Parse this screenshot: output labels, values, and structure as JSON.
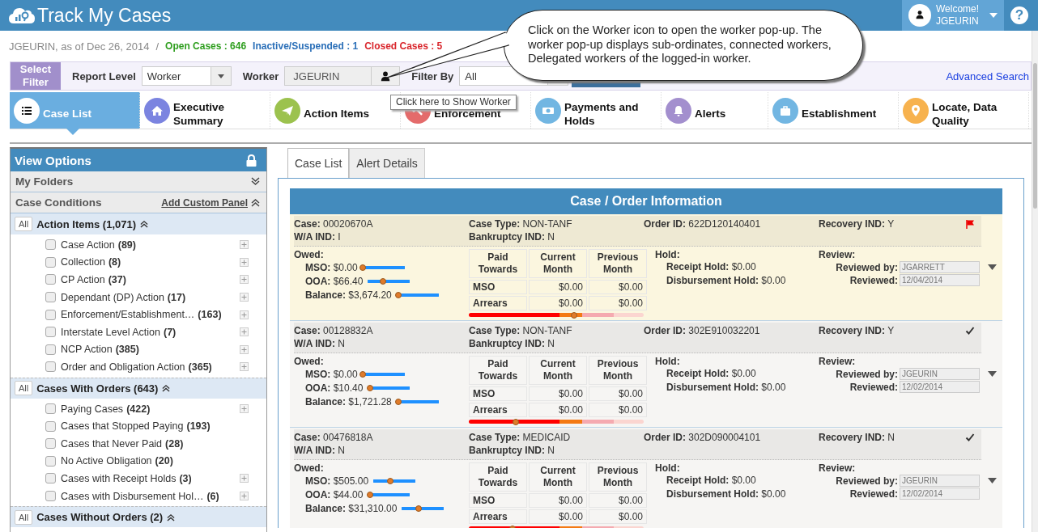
{
  "header": {
    "title": "Track My Cases",
    "welcome": "Welcome!",
    "user": "JGEURIN",
    "help": "?"
  },
  "summary": {
    "user_date": "JGEURIN, as of Dec 26, 2014",
    "separator": "/",
    "stats": [
      {
        "label": "Open Cases : 646",
        "color": "#2e9e1e"
      },
      {
        "label": "Inactive/Suspended : 1",
        "color": "#2a6fb8"
      },
      {
        "label": "Closed Cases : 5",
        "color": "#d9262c"
      }
    ]
  },
  "filter": {
    "select_filter": "Select Filter",
    "report_level_label": "Report Level",
    "report_level": "Worker",
    "worker_label": "Worker",
    "worker": "JGEURIN",
    "filter_by_label": "Filter By",
    "filter_by": "All",
    "advanced_search": "Advanced Search"
  },
  "tooltip": "Click here to Show Worker",
  "callout": "Click on the Worker icon to open the worker pop-up. The worker pop-up displays sub-ordinates, connected workers, Delegated workers of the logged-in worker.",
  "nav_tabs": [
    {
      "label": "Case List",
      "kind": "list",
      "color": "#ffffff",
      "selected": true
    },
    {
      "label": "Executive Summary",
      "kind": "home",
      "color": "#7b84e0",
      "selected": false
    },
    {
      "label": "Action Items",
      "kind": "plane",
      "color": "#9cc24e",
      "selected": false
    },
    {
      "label": "Enforcement",
      "kind": "hammer",
      "color": "#e46b6b",
      "selected": false
    },
    {
      "label": "Payments and Holds",
      "kind": "money",
      "color": "#72b6e2",
      "selected": false
    },
    {
      "label": "Alerts",
      "kind": "bell",
      "color": "#a38fce",
      "selected": false
    },
    {
      "label": "Establishment",
      "kind": "briefcase",
      "color": "#72b6e2",
      "selected": false
    },
    {
      "label": "Locate, Data Quality",
      "kind": "pin",
      "color": "#f7b24e",
      "selected": false
    }
  ],
  "view_options": {
    "title": "View Options",
    "sections": [
      {
        "title": "My Folders",
        "expanded": false
      },
      {
        "title": "Case Conditions",
        "link": "Add Custom Panel",
        "expanded": true
      }
    ],
    "groups": [
      {
        "all": "All",
        "title": "Action Items (1,071)",
        "expanded": true,
        "items": [
          {
            "label": "Case Action",
            "count": "(89)",
            "checked": false,
            "expandable": true
          },
          {
            "label": "Collection",
            "count": "(8)",
            "checked": false,
            "expandable": true
          },
          {
            "label": "CP Action",
            "count": "(37)",
            "checked": false,
            "expandable": true
          },
          {
            "label": "Dependant (DP) Action",
            "count": "(17)",
            "checked": false,
            "expandable": true
          },
          {
            "label": "Enforcement/Establishment…",
            "count": "(163)",
            "checked": false,
            "expandable": true
          },
          {
            "label": "Interstate Level Action",
            "count": "(7)",
            "checked": false,
            "expandable": true
          },
          {
            "label": "NCP Action",
            "count": "(385)",
            "checked": false,
            "expandable": true
          },
          {
            "label": "Order and Obligation Action",
            "count": "(365)",
            "checked": false,
            "expandable": true
          }
        ]
      },
      {
        "all": "All",
        "title": "Cases With Orders (643)",
        "expanded": true,
        "items": [
          {
            "label": "Paying Cases",
            "count": "(422)",
            "checked": false,
            "expandable": true
          },
          {
            "label": "Cases that Stopped Paying",
            "count": "(193)",
            "checked": false,
            "expandable": false
          },
          {
            "label": "Cases that Never Paid",
            "count": "(28)",
            "checked": false,
            "expandable": false
          },
          {
            "label": "No Active Obligation",
            "count": "(20)",
            "checked": false,
            "expandable": false
          },
          {
            "label": "Cases with Receipt Holds",
            "count": "(3)",
            "checked": false,
            "expandable": true
          },
          {
            "label": "Cases with Disbursement Hol…",
            "count": "(6)",
            "checked": false,
            "expandable": true
          }
        ]
      },
      {
        "all": "All",
        "title": "Cases Without Orders (2)",
        "expanded": true
      }
    ]
  },
  "case_tabs": [
    {
      "label": "Case List",
      "selected": true
    },
    {
      "label": "Alert Details",
      "selected": false
    }
  ],
  "panel_title": "Case / Order Information",
  "cases": [
    {
      "highlighted": true,
      "flagged": true,
      "info": [
        [
          "**Case:** 00020670A",
          "**W/A IND:** I"
        ],
        [
          "**Case Type:** NON-TANF",
          "**Bankruptcy IND:** N"
        ],
        [
          "**Order ID:** 622D120140401"
        ],
        [
          "**Recovery IND:** Y"
        ]
      ],
      "owed_title": "Owed:",
      "owed": [
        {
          "text": "**MSO:** $0.00",
          "level": 0
        },
        {
          "text": "**OOA:** $66.40",
          "level": 0.35
        },
        {
          "text": "**Balance:** $3,674.20",
          "level": 0.05
        }
      ],
      "table_head": [
        "Paid Towards",
        "Current Month",
        "Previous Month"
      ],
      "table_rows": [
        [
          "MSO",
          "$0.00",
          "$0.00"
        ],
        [
          "Arrears",
          "$0.00",
          "$0.00"
        ]
      ],
      "bar": {
        "level": 0.6
      },
      "hold_title": "Hold:",
      "holds": [
        "**Receipt Hold:** $0.00",
        "**Disbursement Hold:** $0.00"
      ],
      "review_title": "Review:",
      "review": [
        {
          "label": "Reviewed by:",
          "value": "JGARRETT"
        },
        {
          "label": "Reviewed:",
          "value": "12/04/2014"
        }
      ]
    },
    {
      "highlighted": false,
      "flagged": false,
      "info": [
        [
          "**Case:** 00128832A",
          "**W/A IND:** N"
        ],
        [
          "**Case Type:** NON-TANF",
          "**Bankruptcy IND:** N"
        ],
        [
          "**Order ID:** 302E910032201"
        ],
        [
          "**Recovery IND:** Y"
        ]
      ],
      "owed_title": "Owed:",
      "owed": [
        {
          "text": "**MSO:** $0.00",
          "level": 0
        },
        {
          "text": "**OOA:** $10.40",
          "level": 0.05
        },
        {
          "text": "**Balance:** $1,721.28",
          "level": 0.05
        }
      ],
      "table_head": [
        "Paid Towards",
        "Current Month",
        "Previous Month"
      ],
      "table_rows": [
        [
          "MSO",
          "$0.00",
          "$0.00"
        ],
        [
          "Arrears",
          "$0.00",
          "$0.00"
        ]
      ],
      "bar": {
        "level": 0.27
      },
      "hold_title": "Hold:",
      "holds": [
        "**Receipt Hold:** $0.00",
        "**Disbursement Hold:** $0.00"
      ],
      "review_title": "Review:",
      "review": [
        {
          "label": "Reviewed by:",
          "value": "JGEURIN"
        },
        {
          "label": "Reviewed:",
          "value": "12/02/2014"
        }
      ]
    },
    {
      "highlighted": false,
      "flagged": false,
      "info": [
        [
          "**Case:** 00476818A",
          "**W/A IND:** N"
        ],
        [
          "**Case Type:** MEDICAID",
          "**Bankruptcy IND:** N"
        ],
        [
          "**Order ID:** 302D090004101"
        ],
        [
          "**Recovery IND:** N"
        ]
      ],
      "owed_title": "Owed:",
      "owed": [
        {
          "text": "**MSO:** $505.00",
          "level": 0.4
        },
        {
          "text": "**OOA:** $44.00",
          "level": 0.05
        },
        {
          "text": "**Balance:** $31,310.00",
          "level": 0.4
        }
      ],
      "table_head": [
        "Paid Towards",
        "Current Month",
        "Previous Month"
      ],
      "table_rows": [
        [
          "MSO",
          "$0.00",
          "$0.00"
        ],
        [
          "Arrears",
          "$0.00",
          "$0.00"
        ]
      ],
      "bar": {
        "level": 0.25
      },
      "hold_title": "Hold:",
      "holds": [
        "**Receipt Hold:** $0.00",
        "**Disbursement Hold:** $0.00"
      ],
      "review_title": "Review:",
      "review": [
        {
          "label": "Reviewed by:",
          "value": "JGEURIN"
        },
        {
          "label": "Reviewed:",
          "value": "12/02/2014"
        }
      ]
    }
  ]
}
